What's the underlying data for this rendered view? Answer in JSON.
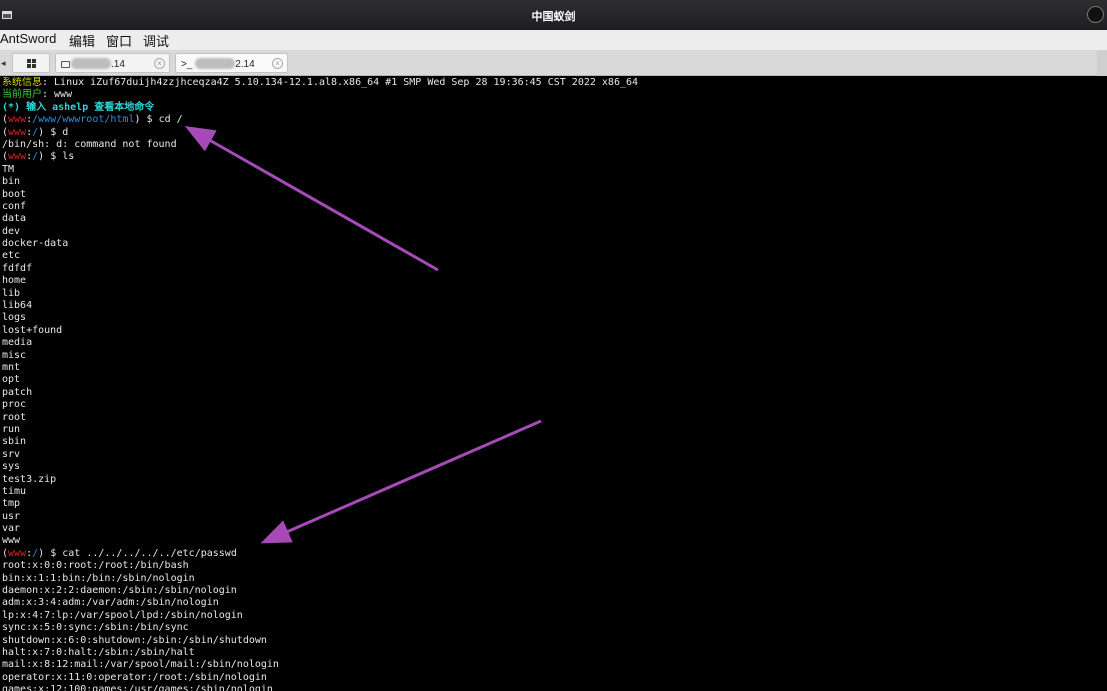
{
  "window": {
    "title": "中国蚁剑"
  },
  "menu": {
    "items": [
      "AntSword",
      "编辑",
      "窗口",
      "调试"
    ]
  },
  "tabs": {
    "scroll_left": "◂",
    "tab1_suffix": ".14",
    "tab2_prefix": ">_",
    "tab2_suffix": "2.14",
    "close_glyph": "×"
  },
  "terminal": {
    "sysinfo_label": "系统信息",
    "sysinfo_value": ": Linux iZuf67duijh4zzjhceqza4Z 5.10.134-12.1.al8.x86_64 #1 SMP Wed Sep 28 19:36:45 CST 2022 x86_64",
    "user_label": "当前用户",
    "user_value": ": www",
    "help": "(*) 输入 ashelp 查看本地命令",
    "prompts": [
      {
        "user": "www",
        "path": "/www/wwwroot/html",
        "cmd": "cd /"
      },
      {
        "user": "www",
        "path": "/",
        "cmd": "d"
      }
    ],
    "error_line": "/bin/sh: d: command not found",
    "prompt_ls": {
      "user": "www",
      "path": "/",
      "cmd": "ls"
    },
    "ls_output": [
      "TM",
      "bin",
      "boot",
      "conf",
      "data",
      "dev",
      "docker-data",
      "etc",
      "fdfdf",
      "home",
      "lib",
      "lib64",
      "logs",
      "lost+found",
      "media",
      "misc",
      "mnt",
      "opt",
      "patch",
      "proc",
      "root",
      "run",
      "sbin",
      "srv",
      "sys",
      "test3.zip",
      "timu",
      "tmp",
      "usr",
      "var",
      "www"
    ],
    "prompt_cat": {
      "user": "www",
      "path": "/",
      "cmd": "cat ../../../../../etc/passwd"
    },
    "passwd_output": [
      "root:x:0:0:root:/root:/bin/bash",
      "bin:x:1:1:bin:/bin:/sbin/nologin",
      "daemon:x:2:2:daemon:/sbin:/sbin/nologin",
      "adm:x:3:4:adm:/var/adm:/sbin/nologin",
      "lp:x:4:7:lp:/var/spool/lpd:/sbin/nologin",
      "sync:x:5:0:sync:/sbin:/bin/sync",
      "shutdown:x:6:0:shutdown:/sbin:/sbin/shutdown",
      "halt:x:7:0:halt:/sbin:/sbin/halt",
      "mail:x:8:12:mail:/var/spool/mail:/sbin/nologin",
      "operator:x:11:0:operator:/root:/sbin/nologin",
      "games:x:12:100:games:/usr/games:/sbin/nologin"
    ]
  },
  "colors": {
    "arrow": "#a64ab8",
    "prompt_user": "#e02020",
    "prompt_path": "#2e8fd6",
    "help_text": "#2dd6d6"
  }
}
